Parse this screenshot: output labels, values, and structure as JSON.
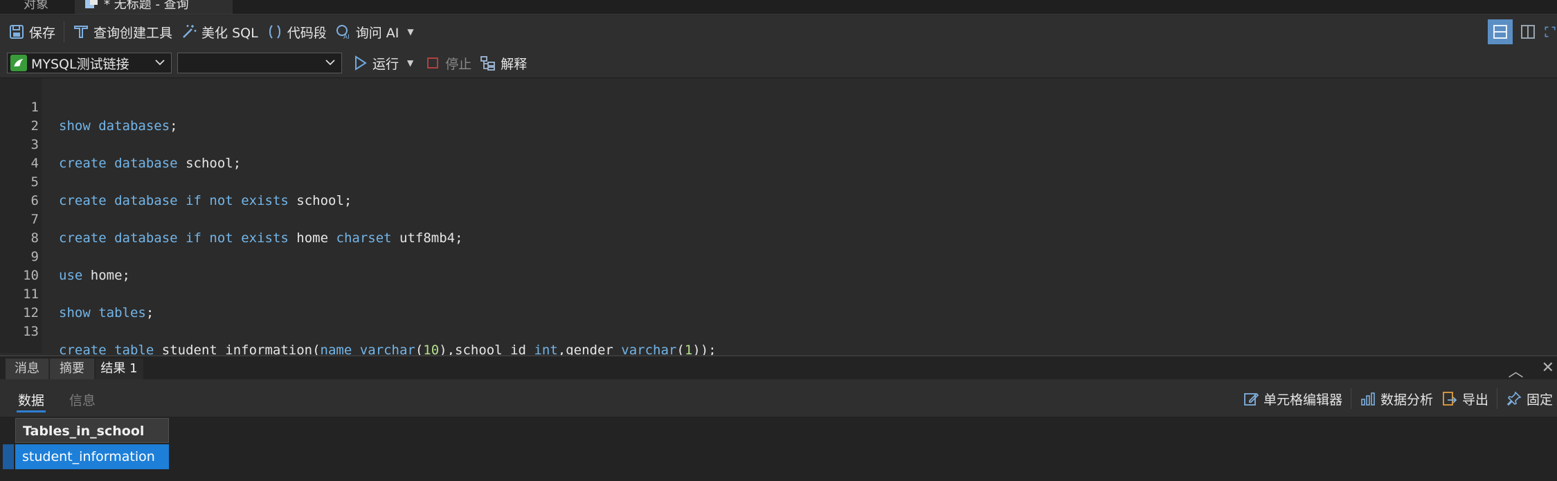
{
  "tabs": [
    {
      "label": "对象"
    },
    {
      "label": "* 无标题 - 查询"
    }
  ],
  "toolbar": {
    "save": "保存",
    "query_builder": "查询创建工具",
    "beautify_sql": "美化 SQL",
    "snippet": "代码段",
    "ask_ai": "询问 AI"
  },
  "run_bar": {
    "connection": "MYSQL测试链接",
    "database": "",
    "run": "运行",
    "stop": "停止",
    "explain": "解释"
  },
  "editor": {
    "lines": [
      {
        "n": "1"
      },
      {
        "n": "2"
      },
      {
        "n": "3"
      },
      {
        "n": "4"
      },
      {
        "n": "5"
      },
      {
        "n": "6"
      },
      {
        "n": "7"
      },
      {
        "n": "8"
      },
      {
        "n": "9"
      },
      {
        "n": "10"
      },
      {
        "n": "11"
      },
      {
        "n": "12"
      },
      {
        "n": "13"
      }
    ],
    "tokens": {
      "show": "show",
      "databases": "databases",
      "semi": ";",
      "create": "create",
      "database": "database",
      "school": "school",
      "if": "if",
      "not": "not",
      "exists": "exists",
      "home": "home",
      "charset": "charset",
      "utf8mb4": "utf8mb4",
      "use": "use",
      "tables": "tables",
      "table": "table",
      "student_information": "student_information(",
      "name": "name",
      "varchar": "varchar",
      "ten_open": "(",
      "ten": "10",
      "after_ten": "),school_id ",
      "int": "int",
      "gender_part": ",gender ",
      "one": "1",
      "end": "));"
    }
  },
  "result_panel": {
    "tabs": [
      {
        "label": "消息"
      },
      {
        "label": "摘要"
      },
      {
        "label": "结果 1"
      }
    ],
    "subtabs": {
      "data": "数据",
      "info": "信息"
    },
    "actions": {
      "cell_editor": "单元格编辑器",
      "data_analysis": "数据分析",
      "export": "导出",
      "pin": "固定"
    },
    "grid": {
      "column": "Tables_in_school",
      "rows": [
        "student_information"
      ]
    }
  }
}
